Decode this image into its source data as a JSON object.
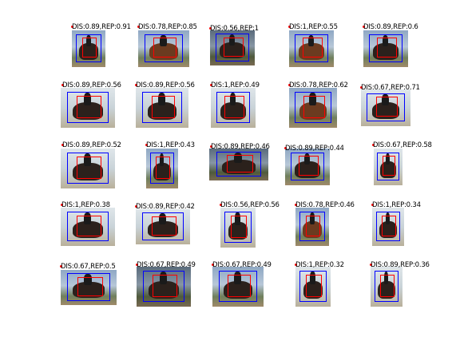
{
  "figure": {
    "cells": [
      {
        "label": "DIS:0.89,REP:0.91"
      },
      {
        "label": "DIS:0.78,REP:0.85"
      },
      {
        "label": "DIS:0.56,REP:1"
      },
      {
        "label": "DIS:1,REP:0.55"
      },
      {
        "label": "DIS:0.89,REP:0.6"
      },
      {
        "label": "DIS:0.89,REP:0.56"
      },
      {
        "label": "DIS:0.89,REP:0.56"
      },
      {
        "label": "DIS:1,REP:0.49"
      },
      {
        "label": "DIS:0.78,REP:0.62"
      },
      {
        "label": "DIS:0.67,REP:0.71"
      },
      {
        "label": "DIS:0.89,REP:0.52"
      },
      {
        "label": "DIS:1,REP:0.43"
      },
      {
        "label": "DIS:0.89,REP:0.46"
      },
      {
        "label": "DIS:0.89,REP:0.44"
      },
      {
        "label": "DIS:0.67,REP:0.58"
      },
      {
        "label": "DIS:1,REP:0.38"
      },
      {
        "label": "DIS:0.89,REP:0.42"
      },
      {
        "label": "DIS:0.56,REP:0.56"
      },
      {
        "label": "DIS:0.78,REP:0.46"
      },
      {
        "label": "DIS:1,REP:0.34"
      },
      {
        "label": "DIS:0.67,REP:0.5"
      },
      {
        "label": "DIS:0.67,REP:0.49"
      },
      {
        "label": "DIS:0.67,REP:0.49"
      },
      {
        "label": "DIS:1,REP:0.32"
      },
      {
        "label": "DIS:0.89,REP:0.36"
      }
    ]
  }
}
